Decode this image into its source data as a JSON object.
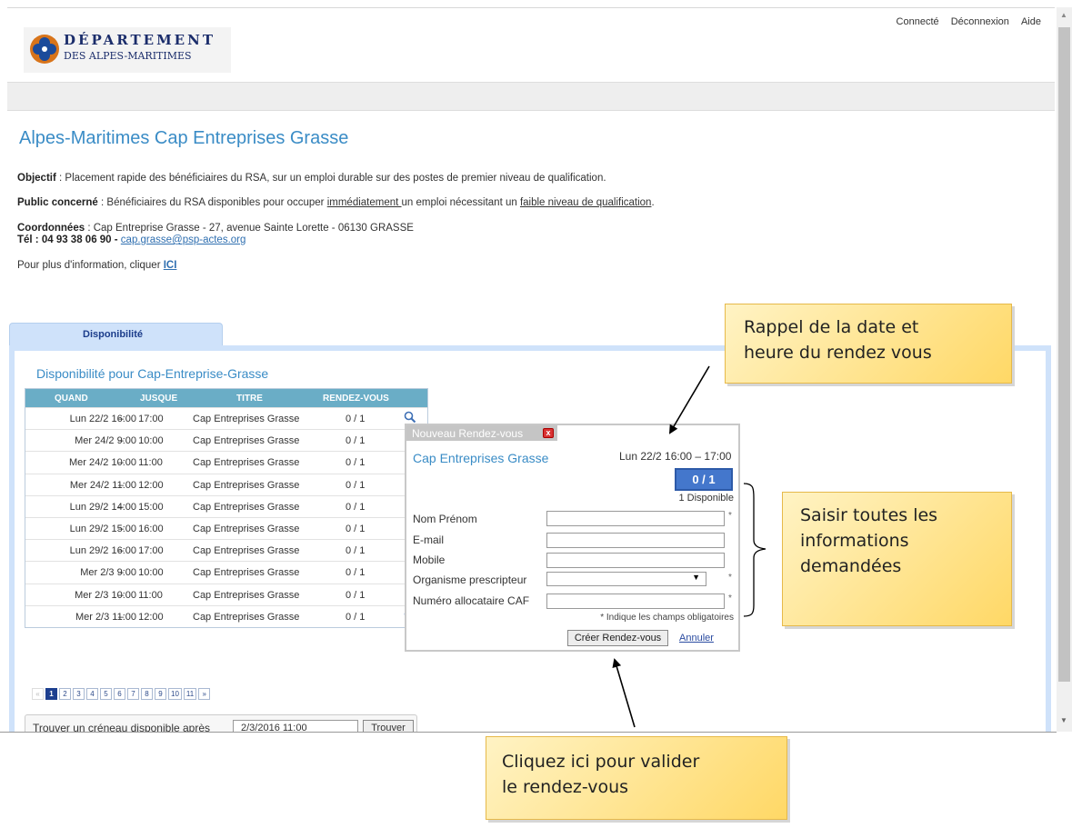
{
  "topnav": [
    "Connecté",
    "Déconnexion",
    "Aide"
  ],
  "logo": {
    "line1": "DÉPARTEMENT",
    "line2": "DES ALPES-MARITIMES"
  },
  "page": {
    "title": "Alpes-Maritimes Cap Entreprises Grasse",
    "objectif_label": "Objectif",
    "objectif_text": " : Placement rapide des bénéficiaires du RSA, sur un emploi durable sur des postes de premier niveau de qualification.",
    "public_label": "Public concerné",
    "public_text_1": " : Bénéficiaires du RSA disponibles pour occuper ",
    "public_u1": "immédiatement ",
    "public_text_2": "un emploi nécessitant un ",
    "public_u2": "faible niveau de qualification",
    "public_text_3": ".",
    "coord_label": "Coordonnées",
    "coord_text": " : Cap Entreprise Grasse - 27, avenue Sainte Lorette - 06130 GRASSE",
    "tel_label": "Tél : 04 93 38 06 90 - ",
    "email": "cap.grasse@psp-actes.org",
    "more_text": "Pour plus d'information, cliquer ",
    "more_link": "ICI"
  },
  "tab_label": "Disponibilité",
  "dispo_title": "Disponibilité pour Cap-Entreprise-Grasse",
  "table": {
    "headers": [
      "QUAND",
      "JUSQUE",
      "TITRE",
      "RENDEZ-VOUS"
    ],
    "rows": [
      {
        "quand": "Lun 22/2 16:00",
        "jusque": "17:00",
        "titre": "Cap Entreprises Grasse",
        "rdv": "0 / 1"
      },
      {
        "quand": "Mer 24/2 9:00",
        "jusque": "10:00",
        "titre": "Cap Entreprises Grasse",
        "rdv": "0 / 1"
      },
      {
        "quand": "Mer 24/2 10:00",
        "jusque": "11:00",
        "titre": "Cap Entreprises Grasse",
        "rdv": "0 / 1"
      },
      {
        "quand": "Mer 24/2 11:00",
        "jusque": "12:00",
        "titre": "Cap Entreprises Grasse",
        "rdv": "0 / 1"
      },
      {
        "quand": "Lun 29/2 14:00",
        "jusque": "15:00",
        "titre": "Cap Entreprises Grasse",
        "rdv": "0 / 1"
      },
      {
        "quand": "Lun 29/2 15:00",
        "jusque": "16:00",
        "titre": "Cap Entreprises Grasse",
        "rdv": "0 / 1"
      },
      {
        "quand": "Lun 29/2 16:00",
        "jusque": "17:00",
        "titre": "Cap Entreprises Grasse",
        "rdv": "0 / 1"
      },
      {
        "quand": "Mer 2/3 9:00",
        "jusque": "10:00",
        "titre": "Cap Entreprises Grasse",
        "rdv": "0 / 1"
      },
      {
        "quand": "Mer 2/3 10:00",
        "jusque": "11:00",
        "titre": "Cap Entreprises Grasse",
        "rdv": "0 / 1"
      },
      {
        "quand": "Mer 2/3 11:00",
        "jusque": "12:00",
        "titre": "Cap Entreprises Grasse",
        "rdv": "0 / 1"
      }
    ],
    "dash": "–"
  },
  "pager": {
    "prev": "«",
    "pages": [
      "1",
      "2",
      "3",
      "4",
      "5",
      "6",
      "7",
      "8",
      "9",
      "10",
      "11"
    ],
    "next": "»",
    "current": "1"
  },
  "finder": {
    "label": "Trouver un créneau disponible après",
    "value": "2/3/2016  11:00",
    "button": "Trouver"
  },
  "dialog": {
    "title": "Nouveau Rendez-vous",
    "close": "x",
    "name": "Cap Entreprises Grasse",
    "date": "Lun 22/2  16:00 – 17:00",
    "count": "0 / 1",
    "available": "1 Disponible",
    "fields": {
      "nom": "Nom Prénom",
      "email": "E-mail",
      "mobile": "Mobile",
      "organisme": "Organisme prescripteur",
      "caf": "Numéro allocataire CAF"
    },
    "required_mark": "*",
    "note": "* Indique les champs obligatoires",
    "create_button": "Créer Rendez-vous",
    "cancel_link": "Annuler"
  },
  "callouts": {
    "rappel": "Rappel de la date et\nheure du rendez vous",
    "saisir": "Saisir toutes  les\ninformations\ndemandées",
    "cliquez": "Cliquez ici pour valider\nle rendez-vous"
  },
  "colors": {
    "accent": "#3a8cc6",
    "header": "#6aadc6",
    "badge": "#4477cc",
    "callout": "#ffd866"
  }
}
